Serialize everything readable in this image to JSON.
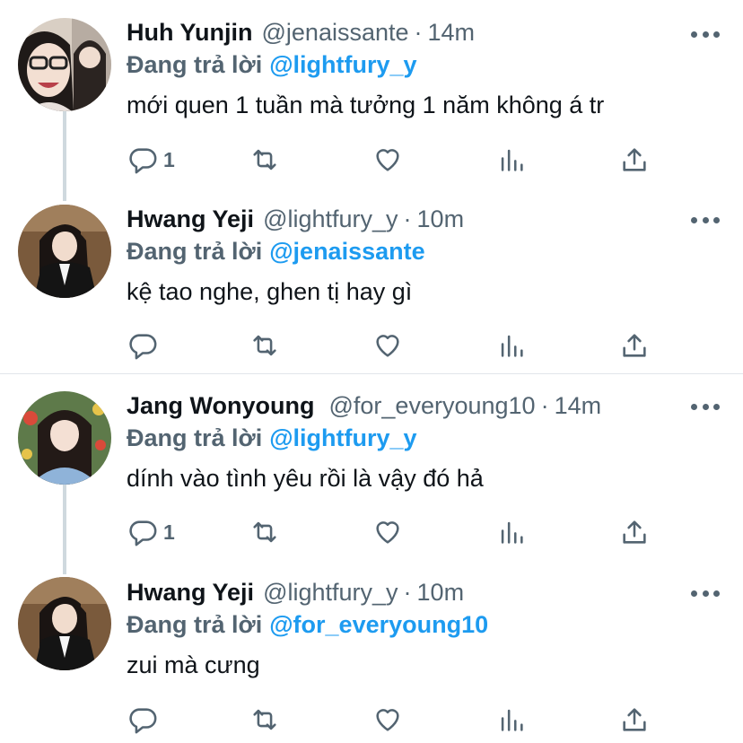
{
  "colors": {
    "accent": "#1d9bf0",
    "text": "#0f1419",
    "secondary": "#536471",
    "thread_line": "#cfd9de"
  },
  "tweets": [
    {
      "name": "Huh Yunjin",
      "handle": "@jenaissante",
      "time": "14m",
      "reply_label": "Đang trả lời",
      "mention": "@lightfury_y",
      "text": "mới quen 1 tuần mà tưởng 1 năm không á tr",
      "reply_count": "1"
    },
    {
      "name": "Hwang Yeji",
      "handle": "@lightfury_y",
      "time": "10m",
      "reply_label": "Đang trả lời",
      "mention": "@jenaissante",
      "text": "kệ tao nghe, ghen tị hay gì",
      "reply_count": ""
    },
    {
      "name": "Jang Wonyoung",
      "handle": "@for_everyoung10",
      "time": "14m",
      "reply_label": "Đang trả lời",
      "mention": "@lightfury_y",
      "text": "dính vào tình yêu rồi là vậy đó hả",
      "reply_count": "1"
    },
    {
      "name": "Hwang Yeji",
      "handle": "@lightfury_y",
      "time": "10m",
      "reply_label": "Đang trả lời",
      "mention": "@for_everyoung10",
      "text": "zui mà cưng",
      "reply_count": ""
    }
  ],
  "separator": "·",
  "icons": [
    "reply-icon",
    "retweet-icon",
    "like-icon",
    "analytics-icon",
    "share-icon",
    "more-icon"
  ]
}
